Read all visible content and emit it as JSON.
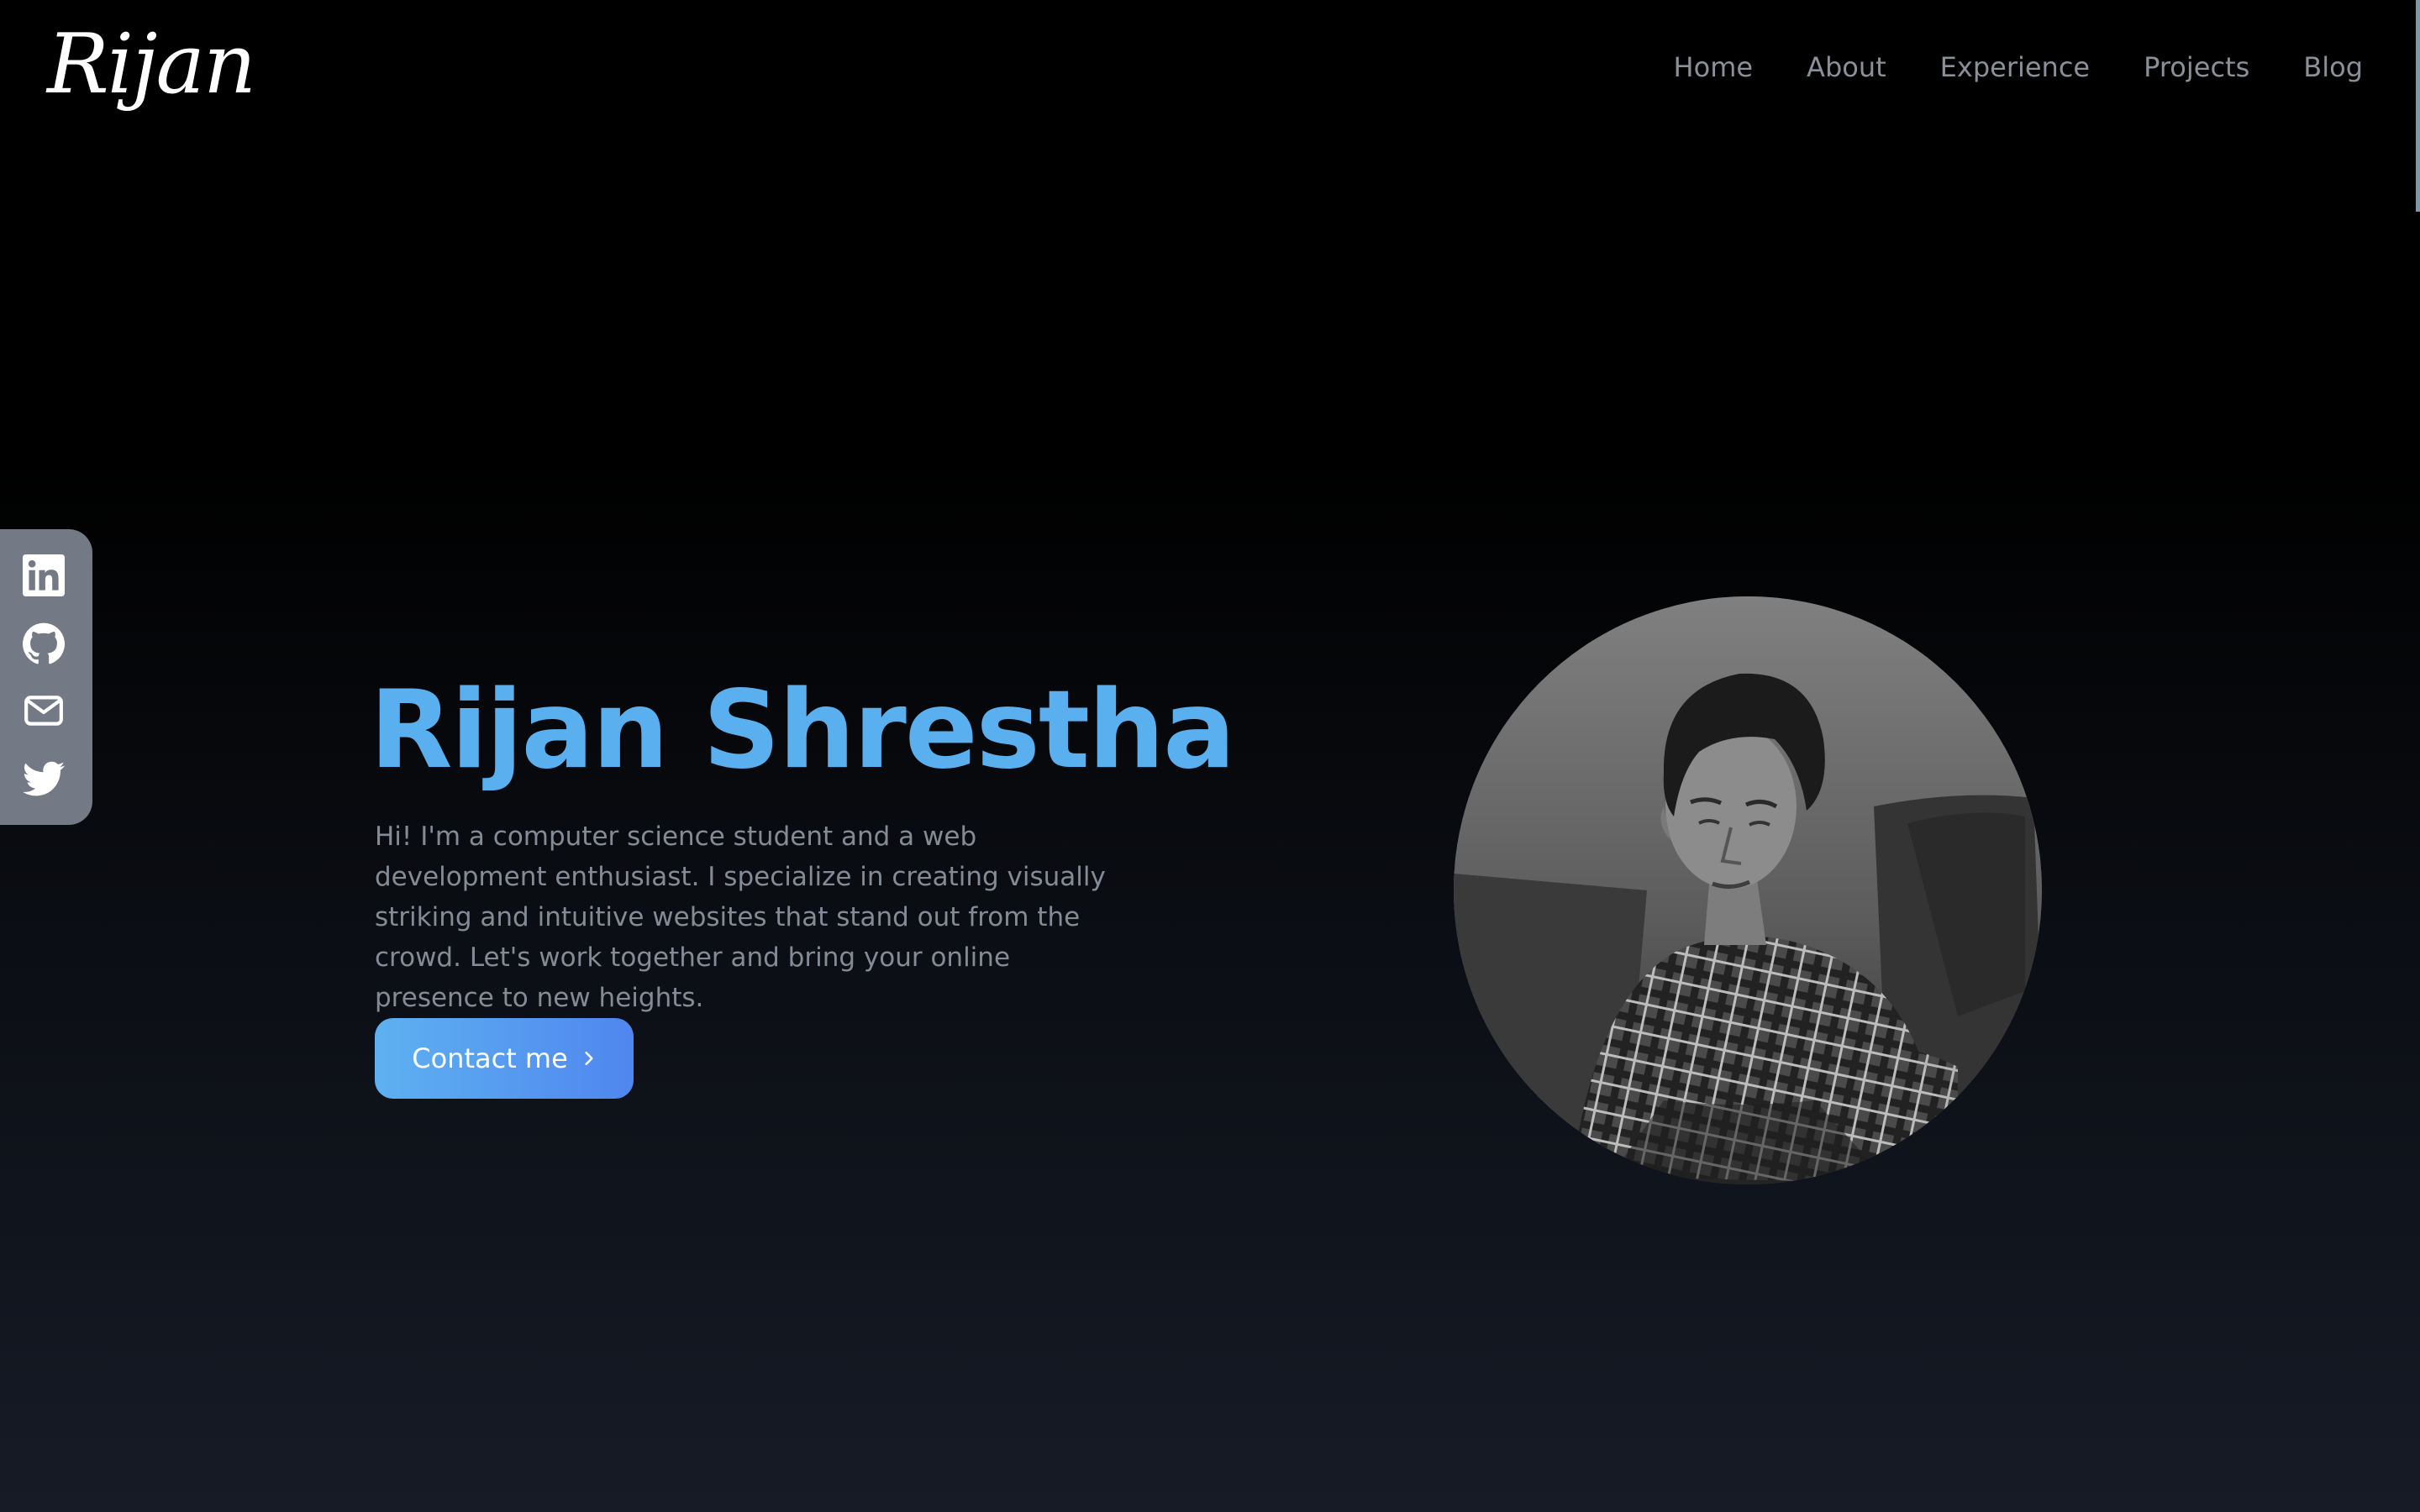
{
  "header": {
    "logo_text": "Rijan",
    "nav": [
      {
        "label": "Home"
      },
      {
        "label": "About"
      },
      {
        "label": "Experience"
      },
      {
        "label": "Projects"
      },
      {
        "label": "Blog"
      }
    ]
  },
  "social": [
    {
      "name": "linkedin-icon"
    },
    {
      "name": "github-icon"
    },
    {
      "name": "mail-icon"
    },
    {
      "name": "twitter-icon"
    }
  ],
  "hero": {
    "name": "Rijan Shrestha",
    "bio": "Hi! I'm a computer science student and a web development enthusiast. I specialize in creating visually striking and intuitive websites that stand out from the crowd. Let's work together and bring your online presence to new heights.",
    "cta_label": "Contact me"
  },
  "colors": {
    "accent": "#5ab0ef",
    "button_start": "#5eb1f1",
    "button_end": "#4f86ef",
    "nav_text": "#8a909a",
    "bio_text": "#858b96",
    "social_bar": "#737985"
  }
}
